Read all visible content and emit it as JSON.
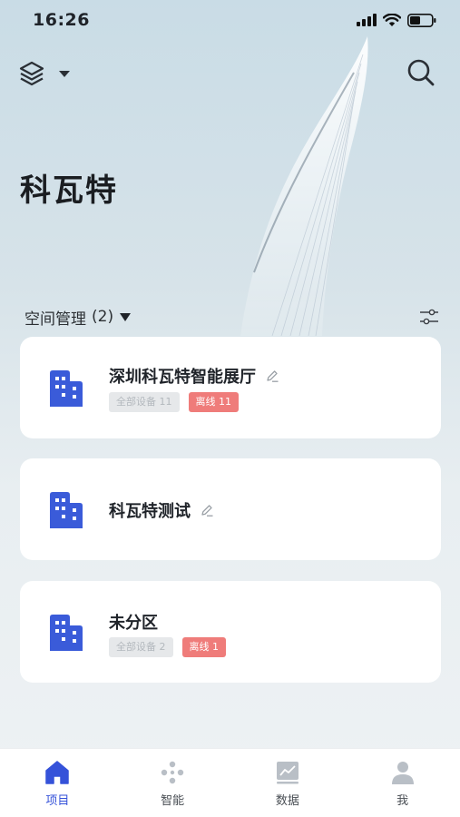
{
  "status_bar": {
    "time": "16:26"
  },
  "header": {
    "title": "科瓦特"
  },
  "section": {
    "label": "空间管理",
    "count": "(2)"
  },
  "cards": [
    {
      "name": "深圳科瓦特智能展厅",
      "tags": [
        "全部设备 11",
        "离线 11"
      ]
    },
    {
      "name": "科瓦特测试"
    },
    {
      "name": "未分区",
      "tags": [
        "全部设备 2",
        "离线 1"
      ]
    }
  ],
  "tabs": [
    {
      "label": "项目",
      "active": true
    },
    {
      "label": "智能"
    },
    {
      "label": "数据"
    },
    {
      "label": "我"
    }
  ],
  "colors": {
    "accent": "#3552d9",
    "offline_tag": "#ef7c7a",
    "building_icon": "#3a5bd9"
  }
}
